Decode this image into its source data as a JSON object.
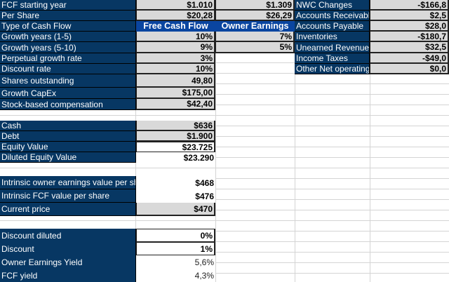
{
  "left_rows": [
    {
      "label": "FCF starting year",
      "fcf": "$1.010",
      "owner": "$1.309"
    },
    {
      "label": "Per Share",
      "fcf": "$20,28",
      "owner": "$26,29"
    },
    {
      "label": "Type of Cash Flow",
      "fcf": "Free Cash Flow",
      "owner": "Owner Earnings"
    },
    {
      "label": "Growth years (1-5)",
      "fcf": "10%",
      "owner": "7%"
    },
    {
      "label": "Growth years (5-10)",
      "fcf": "9%",
      "owner": "5%"
    },
    {
      "label": "Perpetual growth rate",
      "fcf": "3%"
    },
    {
      "label": "Discount rate",
      "fcf": "10%"
    },
    {
      "label": "Shares outstanding",
      "fcf": "49,80"
    },
    {
      "label": "Growth CapEx",
      "fcf": "$175,00"
    },
    {
      "label": "Stock-based compensation",
      "fcf": "$42,40"
    },
    {
      "label": "Cash",
      "fcf": "$636"
    },
    {
      "label": "Debt",
      "fcf": "$1.900"
    },
    {
      "label": "Equity Value",
      "fcf": "$23.725"
    },
    {
      "label": "Diluted Equity Value",
      "fcf": "$23.290"
    },
    {
      "label": "Intrinsic owner earnings value per sh",
      "fcf": "$468"
    },
    {
      "label": "Intrinsic FCF value per share",
      "fcf": "$476"
    },
    {
      "label": "Current price",
      "fcf": "$470"
    },
    {
      "label": "Discount diluted",
      "fcf": "0%"
    },
    {
      "label": "Discount",
      "fcf": "1%"
    },
    {
      "label": "Owner Earnings Yield",
      "fcf": "5,6%"
    },
    {
      "label": "FCF yield",
      "fcf": "4,3%"
    }
  ],
  "nwc_rows": [
    {
      "label": "NWC Changes",
      "value": "-$166,8"
    },
    {
      "label": "Accounts Receivable",
      "value": "$2,5"
    },
    {
      "label": "Accounts Payable",
      "value": "$28,0"
    },
    {
      "label": "Inventories",
      "value": "-$180,7"
    },
    {
      "label": "Unearned Revenues",
      "value": "$32,5"
    },
    {
      "label": "Income Taxes",
      "value": "-$49,0"
    },
    {
      "label": "Other Net operating",
      "value": "$0,0"
    }
  ]
}
